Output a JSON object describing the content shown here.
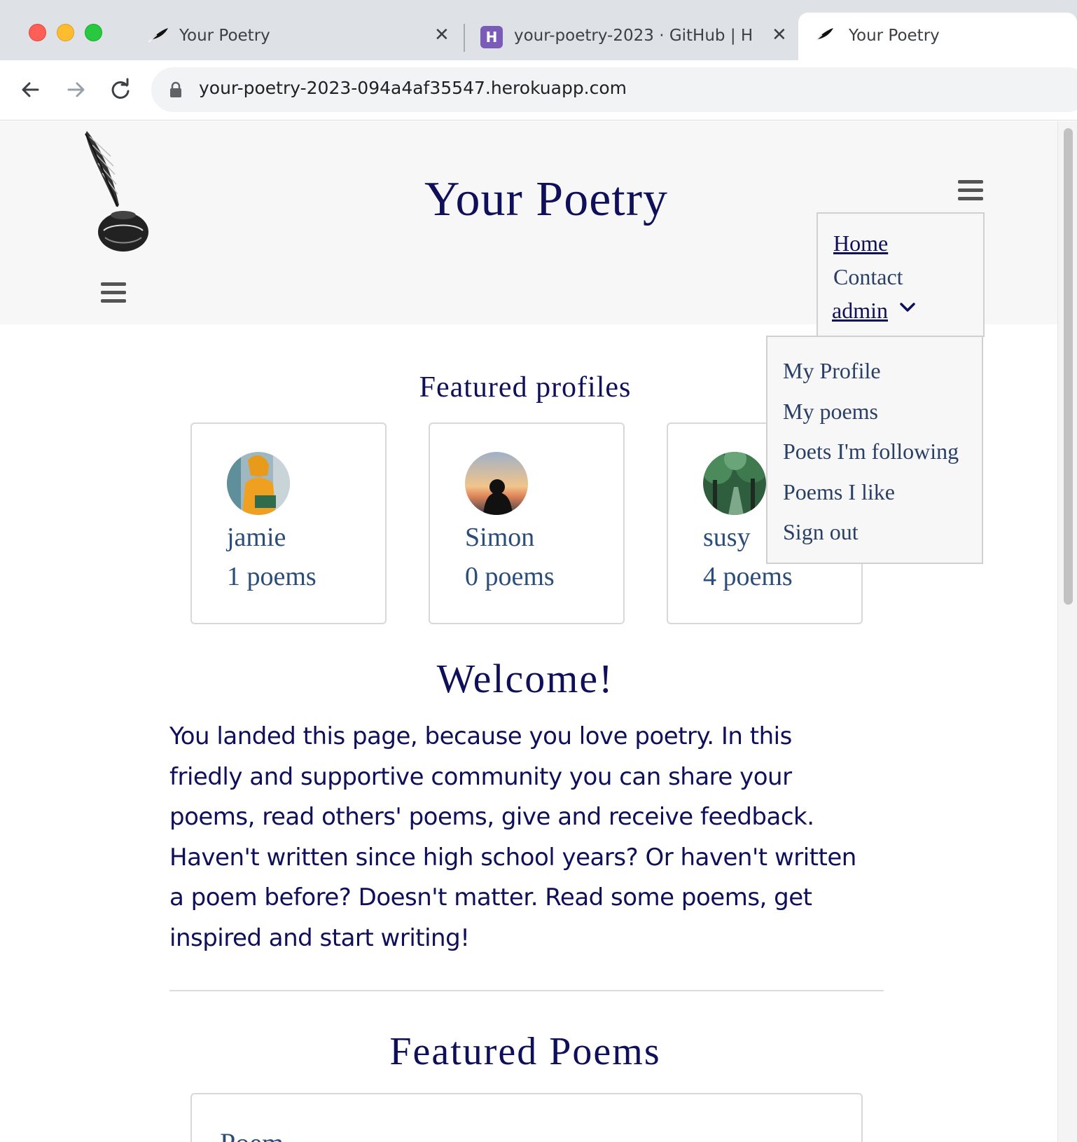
{
  "browser": {
    "tabs": [
      {
        "title": "Your Poetry",
        "icon": "feather-icon",
        "active": false
      },
      {
        "title": "your-poetry-2023 · GitHub | H",
        "icon": "heroku-icon",
        "active": false
      },
      {
        "title": "Your Poetry",
        "icon": "feather-icon",
        "active": true
      }
    ],
    "heroku_glyph": "H",
    "close_glyph": "✕",
    "url": "your-poetry-2023-094a4af35547.herokuapp.com"
  },
  "site": {
    "title": "Your Poetry",
    "nav": {
      "home": "Home",
      "contact": "Contact",
      "admin": "admin"
    },
    "dropdown": {
      "items": [
        "My Profile",
        "My poems",
        "Poets I'm following",
        "Poems I like",
        "Sign out"
      ]
    }
  },
  "featured_profiles": {
    "heading": "Featured profiles",
    "profiles": [
      {
        "name": "jamie",
        "poems": "1 poems"
      },
      {
        "name": "Simon",
        "poems": "0 poems"
      },
      {
        "name": "susy",
        "poems": "4 poems"
      }
    ]
  },
  "welcome": {
    "heading": "Welcome!",
    "text": "You landed this page, because you love poetry. In this friedly and supportive community you can share your poems, read others' poems, give and receive feedback. Haven't written since high school years? Or haven't written a poem before? Doesn't matter. Read some poems, get inspired and start writing!"
  },
  "featured_poems": {
    "heading": "Featured Poems",
    "first_card_title": "Poem"
  },
  "colors": {
    "brand_navy": "#10105a",
    "link_blue": "#2a4d7a",
    "header_bg": "#f7f7f7"
  }
}
